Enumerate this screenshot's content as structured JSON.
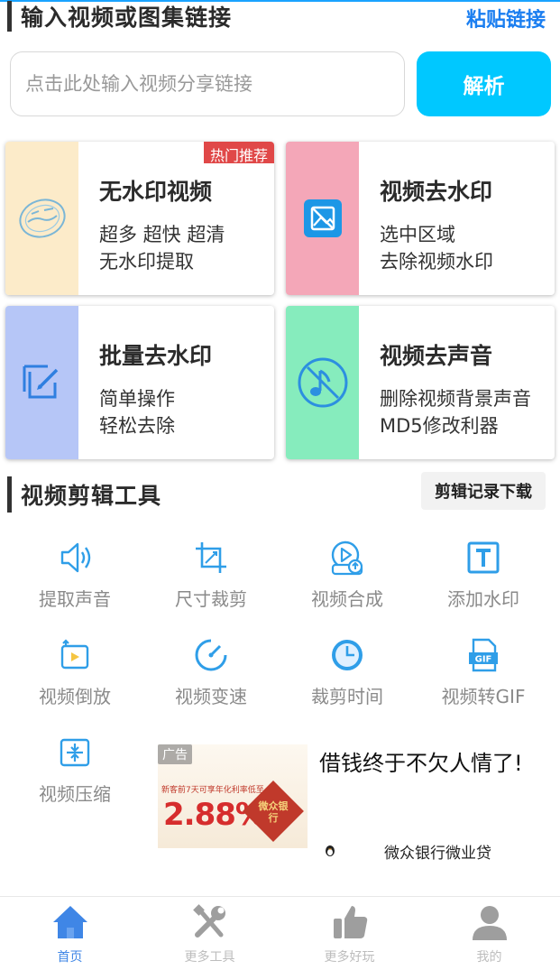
{
  "header": {
    "title": "输入视频或图集链接",
    "paste_label": "粘贴链接"
  },
  "search": {
    "placeholder": "点击此处输入视频分享链接",
    "value": "",
    "parse_label": "解析"
  },
  "cards": [
    {
      "title": "无水印视频",
      "line1": "超多 超快 超清",
      "line2": "无水印提取",
      "tag": "热门推荐",
      "color": "#fcebc9"
    },
    {
      "title": "视频去水印",
      "line1": "选中区域",
      "line2": "去除视频水印",
      "color": "#f4a7b8"
    },
    {
      "title": "批量去水印",
      "line1": "简单操作",
      "line2": "轻松去除",
      "color": "#b6c6f7"
    },
    {
      "title": "视频去声音",
      "line1": "删除视频背景声音",
      "line2": "MD5修改利器",
      "color": "#86ecbd"
    }
  ],
  "tools_section": {
    "title": "视频剪辑工具",
    "records_label": "剪辑记录下载"
  },
  "tools": [
    {
      "label": "提取声音",
      "icon": "speaker-icon"
    },
    {
      "label": "尺寸裁剪",
      "icon": "crop-icon"
    },
    {
      "label": "视频合成",
      "icon": "merge-video-icon"
    },
    {
      "label": "添加水印",
      "icon": "text-watermark-icon"
    },
    {
      "label": "视频倒放",
      "icon": "reverse-icon"
    },
    {
      "label": "视频变速",
      "icon": "speed-icon"
    },
    {
      "label": "裁剪时间",
      "icon": "clock-icon"
    },
    {
      "label": "视频转GIF",
      "icon": "gif-icon"
    },
    {
      "label": "视频压缩",
      "icon": "compress-icon"
    }
  ],
  "ad": {
    "tag": "广告",
    "headline": "借钱终于不欠人情了!",
    "brand": "微众银行微业贷",
    "image_big_text": "2.88%",
    "image_small_text": "新客前7天可享年化利率低至",
    "image_badge": "微众银行"
  },
  "nav": [
    {
      "label": "首页",
      "icon": "home-icon",
      "active": true
    },
    {
      "label": "更多工具",
      "icon": "tools-icon",
      "active": false
    },
    {
      "label": "更多好玩",
      "icon": "thumbs-up-icon",
      "active": false
    },
    {
      "label": "我的",
      "icon": "user-icon",
      "active": false
    }
  ],
  "colors": {
    "accent": "#00c8ff",
    "link": "#1a7ef0",
    "icon_blue": "#2f9ee8",
    "hot": "#e04848",
    "nav_active": "#3f86e6"
  }
}
